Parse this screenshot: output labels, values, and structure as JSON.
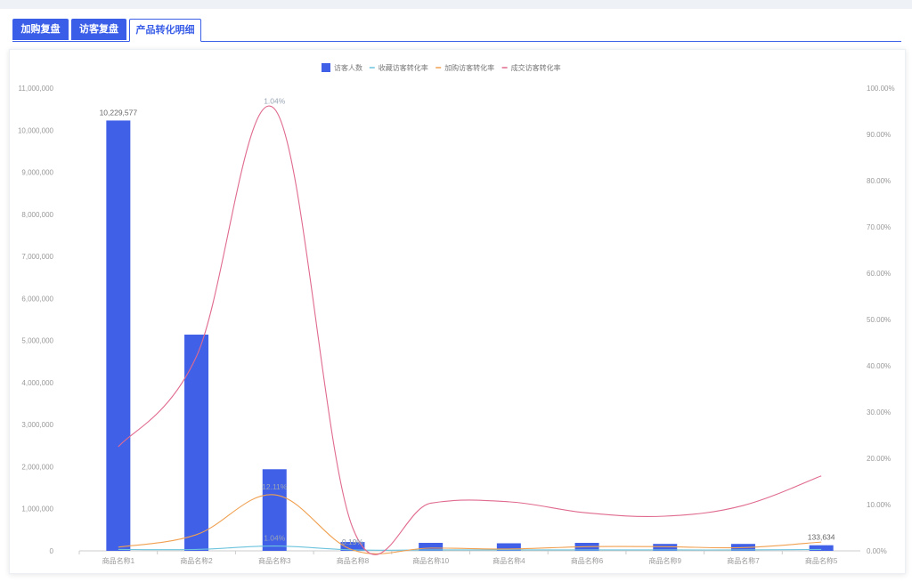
{
  "tabs": [
    {
      "label": "加购复盘",
      "style": "solid"
    },
    {
      "label": "访客复盘",
      "style": "solid"
    },
    {
      "label": "产品转化明细",
      "style": "outline"
    }
  ],
  "colors": {
    "primary": "#3a5ee8",
    "bar": "#4060e8",
    "favorite_line": "#6cc3dd",
    "cart_line": "#f0a050",
    "deal_line": "#e06a8e",
    "axis_text": "#999999",
    "grid": "#f0f0f0"
  },
  "chart_data": {
    "type": "bar",
    "categories": [
      "商品名称1",
      "商品名称2",
      "商品名称3",
      "商品名称8",
      "商品名称10",
      "商品名称4",
      "商品名称6",
      "商品名称9",
      "商品名称7",
      "商品名称5"
    ],
    "y_left_ticks": [
      "0",
      "1,000,000",
      "2,000,000",
      "3,000,000",
      "4,000,000",
      "5,000,000",
      "6,000,000",
      "7,000,000",
      "8,000,000",
      "9,000,000",
      "10,000,000",
      "11,000,000"
    ],
    "y_right_ticks": [
      "0.00%",
      "10.00%",
      "20.00%",
      "30.00%",
      "40.00%",
      "50.00%",
      "60.00%",
      "70.00%",
      "80.00%",
      "90.00%",
      "100.00%"
    ],
    "ylim_left": [
      0,
      11000000
    ],
    "ylim_right": [
      0,
      100
    ],
    "legend_position": "top-center",
    "series": [
      {
        "name": "访客人数",
        "kind": "bar",
        "axis": "left",
        "color": "#4060e8",
        "values": [
          10229577,
          5140000,
          1940000,
          210000,
          190000,
          180000,
          190000,
          165000,
          165000,
          133634
        ]
      },
      {
        "name": "收藏访客转化率",
        "kind": "line",
        "axis": "right",
        "color": "#6cc3dd",
        "values": [
          0.3,
          0.3,
          1.04,
          0.2,
          0.2,
          0.2,
          0.2,
          0.2,
          0.2,
          0.3
        ]
      },
      {
        "name": "加购访客转化率",
        "kind": "line",
        "axis": "right",
        "color": "#f0a050",
        "values": [
          0.8,
          3.5,
          12.11,
          0.19,
          0.6,
          0.4,
          0.9,
          0.9,
          0.7,
          1.9
        ]
      },
      {
        "name": "成交访客转化率",
        "kind": "line",
        "axis": "right",
        "color": "#e06a8e",
        "values": [
          22.5,
          42,
          95.5,
          5,
          10.3,
          10.6,
          8.2,
          7.5,
          9.8,
          16.2
        ]
      }
    ],
    "data_labels": [
      {
        "text": "10,229,577",
        "series": 0,
        "index": 0
      },
      {
        "text": "133,634",
        "series": 0,
        "index": 9
      },
      {
        "text": "1.04%",
        "series": 3,
        "index": 2
      },
      {
        "text": "12.11%",
        "series": 2,
        "index": 2
      },
      {
        "text": "1.04%",
        "series": 1,
        "index": 2
      },
      {
        "text": "0.19%",
        "series": 2,
        "index": 3
      },
      {
        "text": "0.19%",
        "series": 1,
        "index": 3
      }
    ]
  }
}
